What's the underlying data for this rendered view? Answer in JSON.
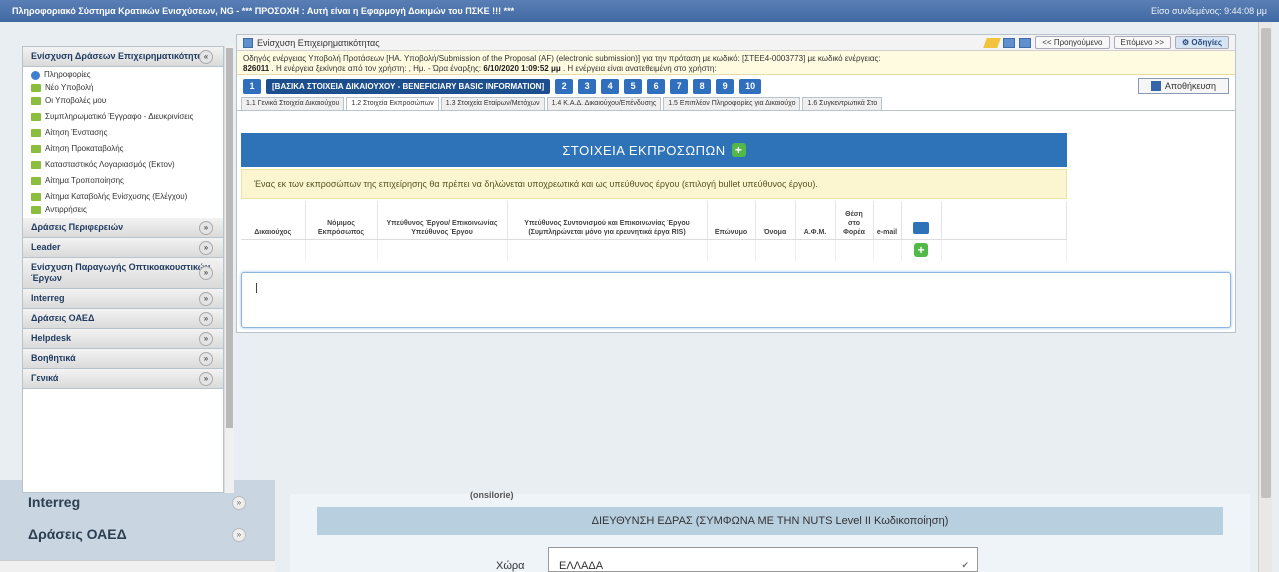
{
  "titlebar": {
    "title": "Πληροφοριακό Σύστημα Κρατικών Ενισχύσεων, ΝG - *** ΠΡΟΣΟΧΗ : Αυτή είναι η Εφαρμογή Δοκιμών του ΠΣΚΕ !!! ***",
    "right": "Είσο συνδεμένος: 9:44:08 μμ"
  },
  "sidebar": {
    "section_title": "Ενίσχυση Δράσεων Επιχειρηματικότητας",
    "items": [
      {
        "label": "Πληροφορίες",
        "icon": "info-icon"
      },
      {
        "label": "Νέο Υποβολή",
        "icon": "folder-icon"
      },
      {
        "label": "Οι Υποβολές μου",
        "icon": "folder-icon"
      },
      {
        "label": "Συμπληρωματικό Έγγραφο - Διευκρινίσεις",
        "icon": "folder-icon"
      },
      {
        "label": "Αίτηση Ένστασης",
        "icon": "folder-icon"
      },
      {
        "label": "Αίτηση Προκαταβολής",
        "icon": "folder-icon"
      },
      {
        "label": "Κατασταστικός Λογαριασμός (Εκτον)",
        "icon": "folder-icon"
      },
      {
        "label": "Αίτημα Τροποποίησης",
        "icon": "folder-icon"
      },
      {
        "label": "Αίτημα Καταβολής Ενίσχυσης (Ελέγχου)",
        "icon": "folder-icon"
      },
      {
        "label": "Αντιρρήσεις",
        "icon": "folder-icon"
      }
    ],
    "groups": [
      "Δράσεις Περιφερειών",
      "Leader",
      "Ενίσχυση Παραγωγής Οπτικοακουστικών Έργων",
      "Interreg",
      "Δράσεις ΟΑΕΔ",
      "Helpdesk",
      "Βοηθητικά",
      "Γενικά"
    ]
  },
  "main": {
    "title": "Ενίσχυση Επιχειρηματικότητας",
    "prev_label": "<< Προηγούμενο",
    "next_label": "Επόμενο >>",
    "help_label": "Οδηγίες",
    "info_line1": "Οδηγός ενέργειας Υποβολή Προτάσεων [ΗΑ. Υποβολή/Submission of the Proposal (AF) (electronic submission)] για την πρόταση με κωδικό: [ΣΤΕΕ4-0003773] με κωδικό ενέργειας:",
    "info_code": "826011",
    "info_line2": ". Η ενέργεια ξεκίνησε από τον χρήστη:",
    "info_date_label": ", Ημ. - Ώρα έναρξης:",
    "info_date": "6/10/2020 1:09:52 μμ",
    "info_line3": ". Η ενέργεια είναι ανατεθειμένη στο χρήστη:",
    "step_active_num": "1",
    "step_active_label": "[ΒΑΣΙΚΑ ΣΤΟΙΧΕΙΑ ΔΙΚΑΙΟΥΧΟΥ - BENEFICIARY BASIC INFORMATION]",
    "steps": [
      "2",
      "3",
      "4",
      "5",
      "6",
      "7",
      "8",
      "9",
      "10"
    ],
    "save_label": "Αποθήκευση",
    "tabs": [
      "1.1 Γενικά Στοιχεία Δικαιούχου",
      "1.2 Στοιχεία Εκπροσώπων",
      "1.3 Στοιχεία Εταίρων/Μετόχων",
      "1.4 Κ.Α.Δ. Δικαιούχου/Επένδυσης",
      "1.5 Επιπλέον Πληροφορίες για Δικαιούχο",
      "1.6 Συγκεντρωτικά Στο"
    ],
    "active_tab": 1,
    "banner_title": "ΣΤΟΙΧΕΙΑ ΕΚΠΡΟΣΩΠΩΝ",
    "notice": "Ένας εκ των εκπροσώπων της επιχείρησης θα πρέπει να δηλώνεται υποχρεωτικά και ως υπεύθυνος έργου (επιλογή bullet υπεύθυνος έργου).",
    "columns": [
      "Δικαιούχος",
      "Νόμιμος Εκπρόσωπος",
      "Υπεύθυνος Έργου/ Επικοινωνίας Υπεύθυνος Έργου",
      "Υπεύθυνος Συντονισμού και Επικοινωνίας Έργου (Συμπληρώνεται μόνο για ερευνητικά έργα RIS)",
      "Επώνυμο",
      "Όνομα",
      "Α.Φ.Μ.",
      "Θέση στο Φορέα",
      "e-mail"
    ]
  },
  "background": {
    "sidebar_items": [
      "Interreg",
      "Δράσεις ΟΑΕΔ"
    ],
    "onsite_label": "(onsilorie)",
    "address_title": "ΔΙΕΥΘΥΝΣΗ ΕΔΡΑΣ (ΣΥΜΦΩΝΑ ΜΕ ΤΗΝ NUTS Level II Κωδικοποίηση)",
    "country_label": "Χώρα",
    "country_value": "ΕΛΛΑΔΑ"
  }
}
